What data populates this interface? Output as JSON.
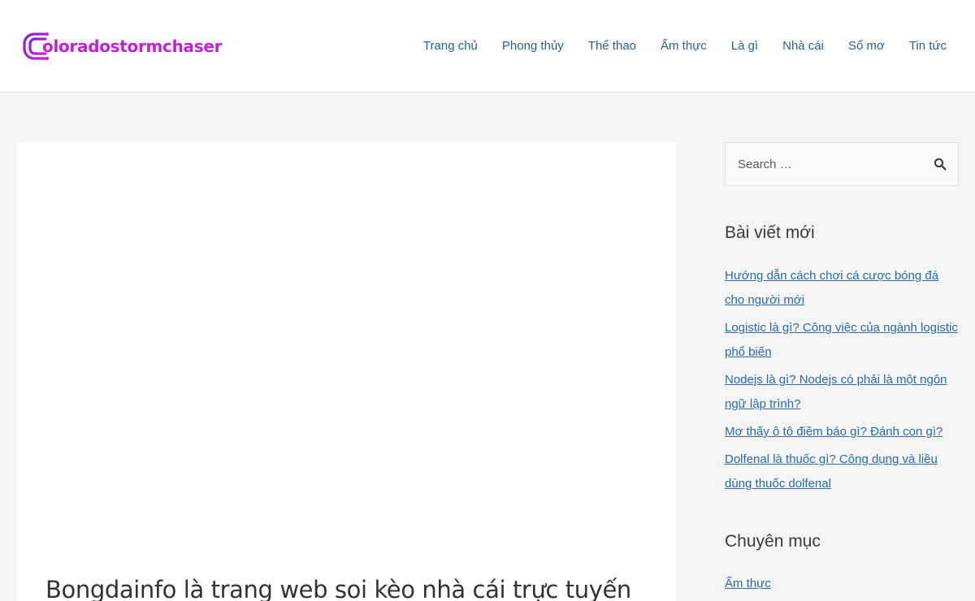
{
  "header": {
    "logo_text": "oloradostormchaser",
    "nav": [
      {
        "label": "Trang chủ"
      },
      {
        "label": "Phong thủy"
      },
      {
        "label": "Thể thao"
      },
      {
        "label": "Ẩm thực"
      },
      {
        "label": "Là gì"
      },
      {
        "label": "Nhà cái"
      },
      {
        "label": "Sổ mơ"
      },
      {
        "label": "Tin tức"
      }
    ]
  },
  "article": {
    "title": "Bongdainfo là trang web soi kèo nhà cái trực tuyến"
  },
  "sidebar": {
    "search": {
      "placeholder": "Search …",
      "icon": "search-icon"
    },
    "recent_posts": {
      "title": "Bài viết mới",
      "items": [
        {
          "label": "Hướng dẫn cách chơi cá cược bóng đá cho người mới"
        },
        {
          "label": "Logistic là gì? Công việc của ngành logistic phổ biến"
        },
        {
          "label": "Nodejs là gì? Nodejs có phải là một ngôn ngữ lập trình?"
        },
        {
          "label": "Mơ thấy ô tô điềm báo gì? Đánh con gì?"
        },
        {
          "label": "Dolfenal là thuốc gì? Công dụng và liều dùng thuốc dolfenal"
        }
      ]
    },
    "categories": {
      "title": "Chuyên mục",
      "items": [
        {
          "label": "Ẩm thực"
        }
      ]
    }
  },
  "colors": {
    "brand": "#c41fd8",
    "brand_dark": "#7a1fe0",
    "nav": "#2b5f8f",
    "link": "#2b6aa8"
  }
}
